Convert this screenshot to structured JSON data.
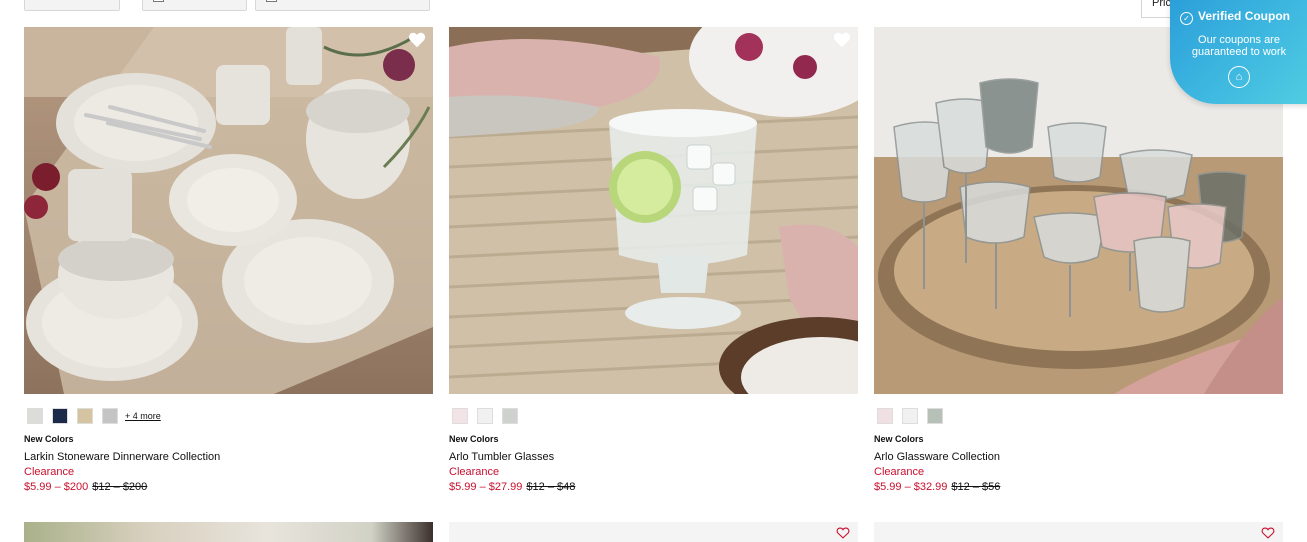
{
  "filters": {
    "sort_value": "Price, low to high"
  },
  "coupon": {
    "title": "Verified Coupon",
    "subtitle": "Our coupons are guaranteed to work",
    "check_icon": "check-circle-icon",
    "badge_icon": "coupon-logo-icon"
  },
  "products": [
    {
      "badge": "New Colors",
      "name": "Larkin Stoneware Dinnerware Collection",
      "status": "Clearance",
      "sale_price": "$5.99 – $200",
      "original_price": "$12 – $200",
      "swatches": [
        "#dcdcd8",
        "#1b2a4a",
        "#d4c4a2",
        "#c4c4c4"
      ],
      "more_colors": "+ 4 more",
      "favorite_icon": "heart-icon"
    },
    {
      "badge": "New Colors",
      "name": "Arlo Tumbler Glasses",
      "status": "Clearance",
      "sale_price": "$5.99 – $27.99",
      "original_price": "$12 – $48",
      "swatches": [
        "#f1e3e6",
        "#f1f1f1",
        "#cfd1cf"
      ],
      "favorite_icon": "heart-icon"
    },
    {
      "badge": "New Colors",
      "name": "Arlo Glassware Collection",
      "status": "Clearance",
      "sale_price": "$5.99 – $32.99",
      "original_price": "$12 – $56",
      "swatches": [
        "#f0dfe3",
        "#f1f1f1",
        "#b7c0b6"
      ],
      "favorite_icon": "heart-icon"
    }
  ],
  "colors": {
    "price_red": "#c8102e",
    "coupon_blue": "#2a9dd9"
  }
}
